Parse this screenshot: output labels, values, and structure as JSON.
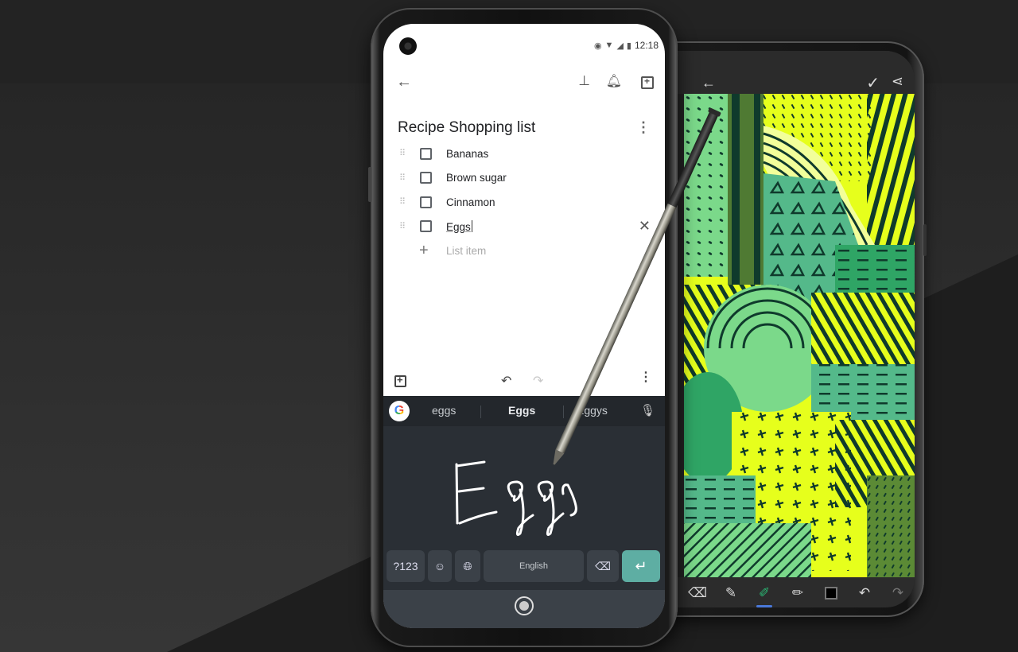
{
  "background": {
    "base": "#2a2a2a",
    "dark_wedge": "#1e1e1e"
  },
  "drawing_app": {
    "back_icon": "arrow-left-icon",
    "confirm_icon": "check-icon",
    "share_icon": "share-icon",
    "tools": [
      {
        "name": "eraser",
        "icon": "eraser-icon",
        "glyph": "⌫",
        "active": false
      },
      {
        "name": "pencil",
        "icon": "pencil-icon",
        "glyph": "✎",
        "active": false
      },
      {
        "name": "marker",
        "icon": "marker-icon",
        "glyph": "✐",
        "active": true,
        "tip_color": "#2bb673"
      },
      {
        "name": "brush",
        "icon": "brush-icon",
        "glyph": "✏",
        "active": false
      },
      {
        "name": "color",
        "icon": "color-swatch-icon",
        "value": "#000000"
      },
      {
        "name": "undo",
        "icon": "undo-icon",
        "glyph": "↶"
      },
      {
        "name": "redo",
        "icon": "redo-icon",
        "glyph": "↷",
        "disabled": true
      }
    ],
    "artwork_colors": [
      "#3f7a3a",
      "#7bd98a",
      "#e6ff1c",
      "#2fa565",
      "#54b98a",
      "#0f3a2c",
      "#f2ff9a",
      "#5b8a35"
    ]
  },
  "keep_note": {
    "status_bar": {
      "icons": [
        "eye-icon",
        "wifi-icon",
        "signal-icon",
        "battery-icon"
      ],
      "time": "12:18"
    },
    "toolbar": {
      "back_icon": "arrow-left-icon",
      "pin_icon": "pin-icon",
      "reminder_icon": "bell-add-icon",
      "archive_icon": "archive-icon"
    },
    "title": "Recipe Shopping list",
    "items": [
      {
        "text": "Bananas",
        "checked": false
      },
      {
        "text": "Brown sugar",
        "checked": false
      },
      {
        "text": "Cinnamon",
        "checked": false
      },
      {
        "text": "Eggs",
        "checked": false,
        "editing": true
      }
    ],
    "add_item_placeholder": "List item",
    "bottom_bar": {
      "add_icon": "add-box-icon",
      "undo_icon": "undo-icon",
      "redo_icon": "redo-icon",
      "more_icon": "more-vert-icon"
    }
  },
  "keyboard": {
    "suggestions": [
      "eggs",
      "Eggs",
      "Eggys"
    ],
    "selected_suggestion": "Eggs",
    "handwriting_text": "Eggs",
    "keys": {
      "symbols": "?123",
      "emoji_icon": "emoji-icon",
      "language_icon": "globe-icon",
      "space": "English",
      "backspace_icon": "backspace-icon",
      "enter_icon": "enter-icon"
    },
    "accent_color": "#5eaea3"
  }
}
